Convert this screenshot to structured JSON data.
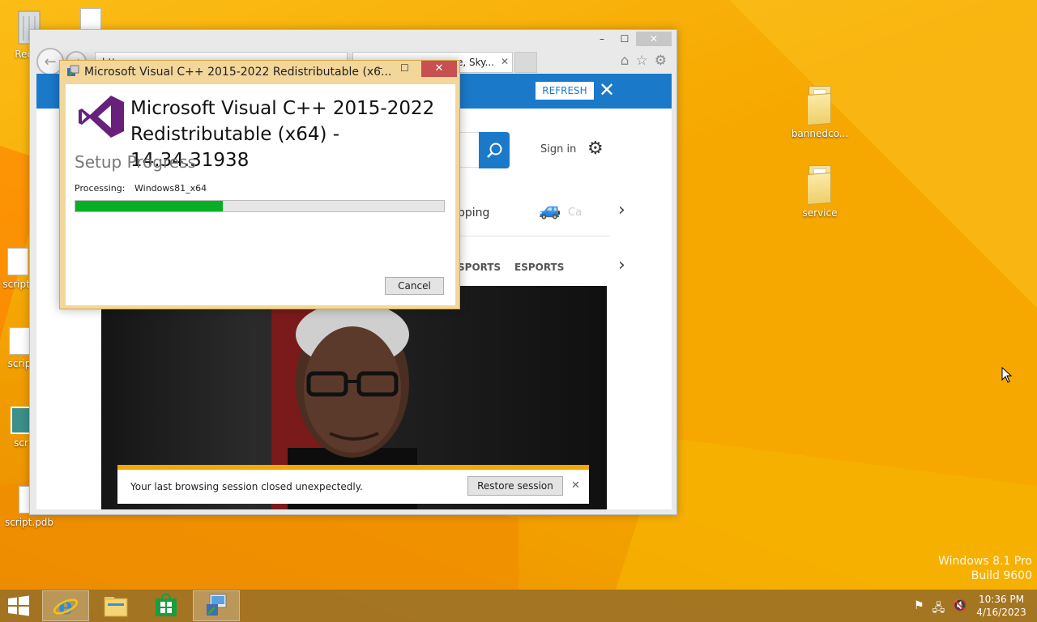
{
  "desktop": {
    "icons_left": [
      {
        "label": "Recyc"
      },
      {
        "label": "script."
      },
      {
        "label": "scrip"
      },
      {
        "label": "scr"
      },
      {
        "label": "script.pdb"
      }
    ],
    "icons_right": [
      {
        "label": "bannedco..."
      },
      {
        "label": "service"
      }
    ],
    "watermark": {
      "line1": "Windows 8.1 Pro",
      "line2": "Build 9600"
    }
  },
  "ie": {
    "caption": {
      "min": "–",
      "max": "☐",
      "close": "✕"
    },
    "tab1": {
      "text": "http..."
    },
    "tab2": {
      "text": "...ce, Sky...",
      "close": "✕"
    },
    "notification_refresh": {
      "button": "REFRESH",
      "close": "✕"
    },
    "header": {
      "sign_in": "Sign in"
    },
    "categories": {
      "shopping": "pping",
      "car_label": "Ca"
    },
    "nav": {
      "sports": "SPORTS",
      "esports": "ESPORTS"
    },
    "restore_bar": {
      "message": "Your last browsing session closed unexpectedly.",
      "button": "Restore session",
      "close": "✕"
    }
  },
  "installer": {
    "title": "Microsoft Visual C++ 2015-2022 Redistributable (x6...",
    "heading_line1": "Microsoft Visual C++ 2015-2022",
    "heading_line2": "Redistributable (x64) - 14.34.31938",
    "subtitle": "Setup Progress",
    "processing_label": "Processing:",
    "processing_value": "Windows81_x64",
    "progress_percent": 40,
    "cancel": "Cancel",
    "caption": {
      "min": "–",
      "max": "☐",
      "close": "✕"
    },
    "accent_color": "#06b025"
  },
  "taskbar": {
    "clock_time": "10:36 PM",
    "clock_date": "4/16/2023"
  }
}
